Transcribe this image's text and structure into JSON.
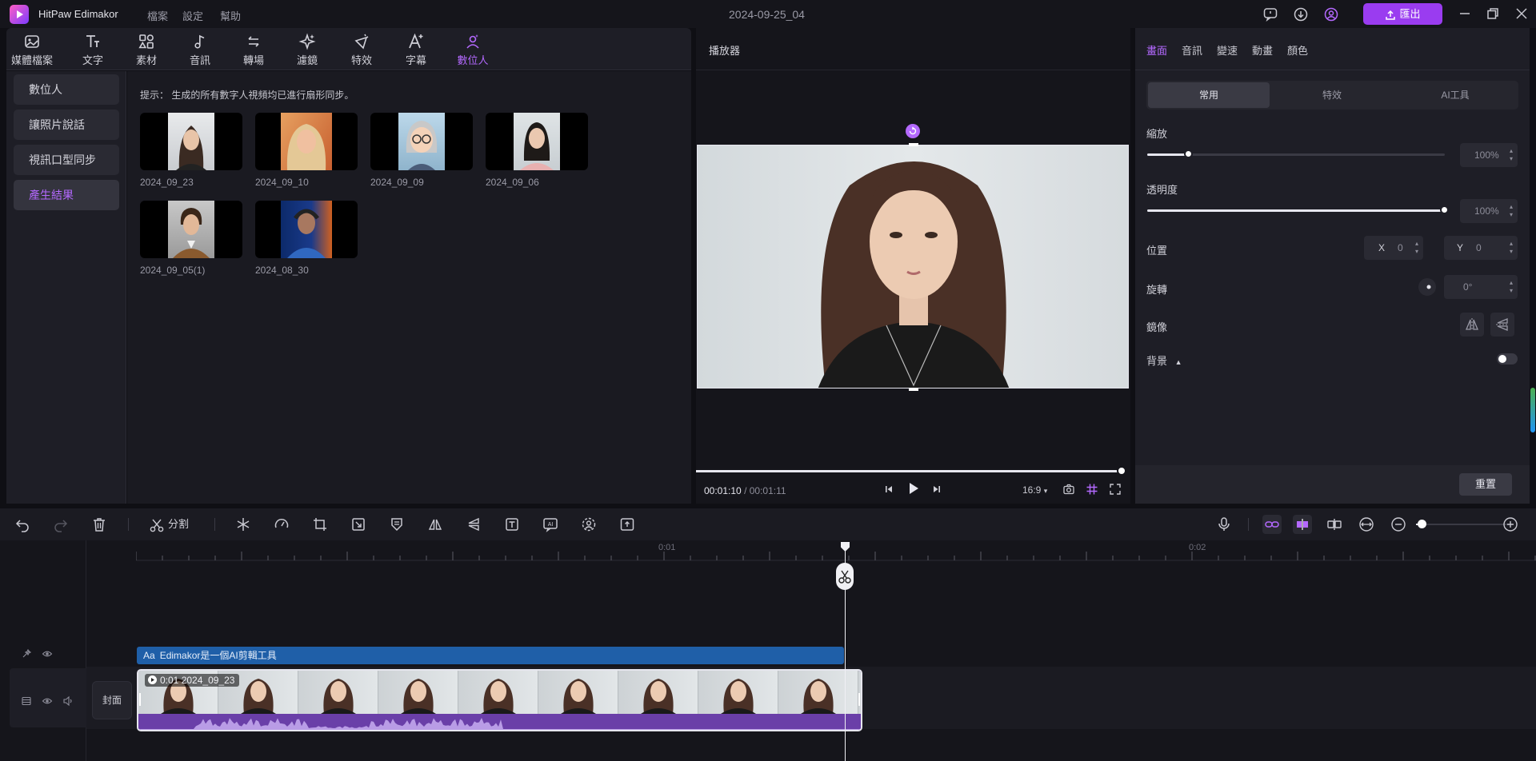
{
  "app": {
    "name": "HitPaw Edimakor",
    "project_title": "2024-09-25_04",
    "export_label": "匯出"
  },
  "menu": [
    "檔案",
    "設定",
    "幫助"
  ],
  "toolbar": [
    {
      "label": "媒體檔案",
      "icon": "media-icon"
    },
    {
      "label": "文字",
      "icon": "text-icon"
    },
    {
      "label": "素材",
      "icon": "assets-icon"
    },
    {
      "label": "音訊",
      "icon": "audio-icon"
    },
    {
      "label": "轉場",
      "icon": "transition-icon"
    },
    {
      "label": "濾鏡",
      "icon": "filter-icon"
    },
    {
      "label": "特效",
      "icon": "effects-icon"
    },
    {
      "label": "字幕",
      "icon": "subtitle-icon"
    },
    {
      "label": "數位人",
      "icon": "digital-human-icon"
    }
  ],
  "leftnav": [
    "數位人",
    "讓照片說話",
    "視訊口型同步",
    "產生結果"
  ],
  "hint": "提示： 生成的所有數字人視頻均已進行扇形同步。",
  "results": [
    "2024_09_23",
    "2024_09_10",
    "2024_09_09",
    "2024_09_06",
    "2024_09_05(1)",
    "2024_08_30"
  ],
  "player": {
    "title": "播放器",
    "current_time": "00:01:10",
    "separator": "/",
    "total_time": "00:01:11",
    "aspect": "16:9",
    "progress": 0.99
  },
  "props": {
    "tabs": [
      "畫面",
      "音訊",
      "變速",
      "動畫",
      "顏色"
    ],
    "subtabs": [
      "常用",
      "特效",
      "AI工具"
    ],
    "scale_label": "縮放",
    "scale_value": "100%",
    "scale_level": 0.14,
    "opacity_label": "透明度",
    "opacity_value": "100%",
    "opacity_level": 1.0,
    "position_label": "位置",
    "x_label": "X",
    "x_value": "0",
    "y_label": "Y",
    "y_value": "0",
    "rotate_label": "旋轉",
    "rotate_value": "0°",
    "mirror_label": "鏡像",
    "background_label": "背景",
    "reset_label": "重置"
  },
  "timeline": {
    "split_label": "分割",
    "ruler": [
      "0:01",
      "0:02"
    ],
    "text_clip": "Edimakor是一個AI剪輯工具",
    "video_clip_time": "0:01",
    "video_clip_name": "2024_09_23",
    "cover_label": "封面"
  },
  "colors": {
    "accent": "#b469ff",
    "text_clip": "#1f5fa8",
    "audio": "#6a3fa8"
  }
}
